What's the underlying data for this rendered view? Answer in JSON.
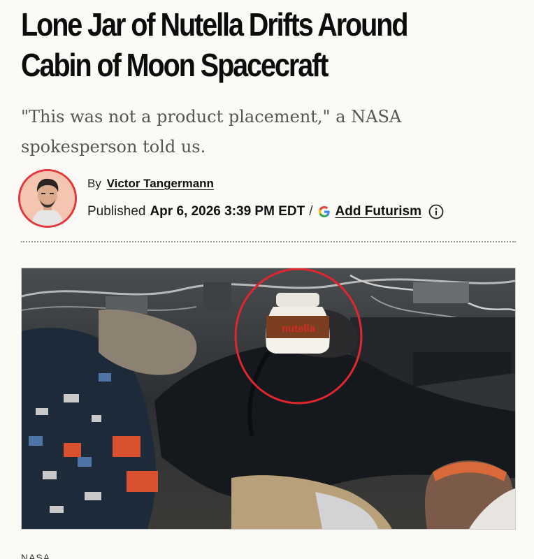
{
  "article": {
    "headline": "Lone Jar of Nutella Drifts Around Cabin of Moon Spacecraft",
    "subhead": "\"This was not a product placement,\" a NASA spokesperson told us.",
    "byline": {
      "prefix": "By",
      "author": "Victor Tangermann"
    },
    "meta": {
      "published_label": "Published",
      "date": "Apr 6, 2026 3:39 PM EDT",
      "separator": "/",
      "add_source_label": "Add Futurism"
    },
    "photo": {
      "jar_label": "nutella",
      "annotation_color": "#e0262e"
    },
    "caption": "NASA"
  },
  "icons": {
    "google": "google-g-icon",
    "info": "info-circle-icon"
  },
  "colors": {
    "background": "#fbfaf6",
    "avatar_ring": "#e2373c",
    "subhead_text": "#555555"
  }
}
